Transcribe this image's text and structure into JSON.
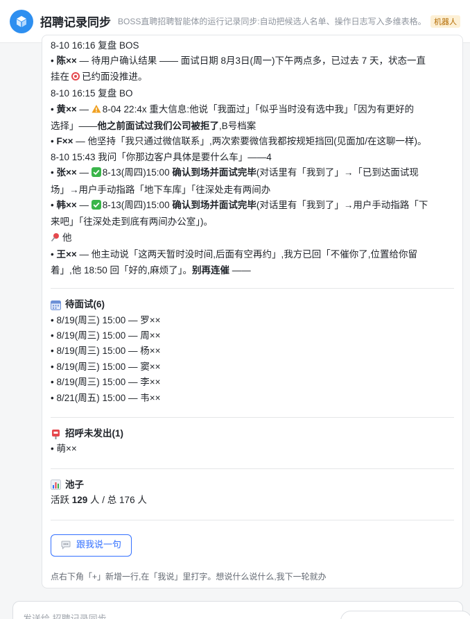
{
  "header": {
    "title": "招聘记录同步",
    "description": "BOSS直聘招聘智能体的运行记录同步:自动把候选人名单、操作日志写入多维表格。",
    "badge": "机器人"
  },
  "log": {
    "l1": "8-10 16:16 复盘 BOS",
    "l2_name": "陈××",
    "l2_text": " — 待用户确认结果 —— 面试日期 8月3日(周一)下午两点多，已过去 7 天，状态一直",
    "l3_text": "挂在",
    "l3_text2": "已约面没推进。",
    "l4": "8-10 16:15 复盘 BO",
    "l5_name": "黄××",
    "l5_text": " — ",
    "l5_text2": "8-04 22:4x 重大信息:他说「我面过」「似乎当时没有选中我」「因为有更好的",
    "l6_text": "选择」——",
    "l6_bold": "他之前面试过我们公司被拒了",
    "l6_text2": ",B号档案",
    "l7_name": "F××",
    "l7_text": " — 他坚持「我只通过微信联系」,两次索要微信我都按规矩挡回(见面加/在这聊一样)。",
    "l8": "8-10 15:43 我问「你那边客户具体是要什么车」——4",
    "l9_name": "张××",
    "l9_text": " — ",
    "l9_text2": "8-13(周四)15:00 ",
    "l9_bold": "确认到场并面试完毕",
    "l9_text3": "(对话里有「我到了」→「已到达面试现",
    "l10": "场」→用户手动指路「地下车库」「往深处走有两间办",
    "l11_name": "韩××",
    "l11_text": " — ",
    "l11_text2": "8-13(周四)15:00 ",
    "l11_bold": "确认到场并面试完毕",
    "l11_text3": "(对话里有「我到了」→用户手动指路「下",
    "l12": "来吧」「往深处走到底有两间办公室」)。",
    "l13": "他",
    "l14_name": "王××",
    "l14_text": " — 他主动说「这两天暂时没时间,后面有空再约」,我方已回「不催你了,位置给你留",
    "l15_text": "着」,他 18:50 回「好的,麻烦了」。",
    "l15_bold": "别再连催",
    "l15_text2": " ——"
  },
  "pending": {
    "title": "待面试(6)",
    "items": [
      "• 8/19(周三) 15:00 — 罗××",
      "• 8/19(周三) 15:00 — 周××",
      "• 8/19(周三) 15:00 — 杨××",
      "• 8/19(周三) 15:00 — 窦××",
      "• 8/19(周三) 15:00 — 李××",
      "• 8/21(周五) 15:00 — 韦××"
    ]
  },
  "unsent": {
    "title": "招呼未发出(1)",
    "items": [
      "• 萌××"
    ]
  },
  "pool": {
    "title": "池子",
    "prefix": "活跃 ",
    "active": "129",
    "suffix": " 人 / 总 176 人"
  },
  "reply_button": "跟我说一句",
  "hint": "点右下角「+」新增一行,在「我说」里打字。想说什么说什么,我下一轮就办",
  "composer": {
    "placeholder": "发送给 招聘记录同步"
  },
  "colors": {
    "accent": "#3370ff",
    "logo": "#2e8ff0",
    "check": "#3ab54a",
    "warning": "#f0a020"
  }
}
